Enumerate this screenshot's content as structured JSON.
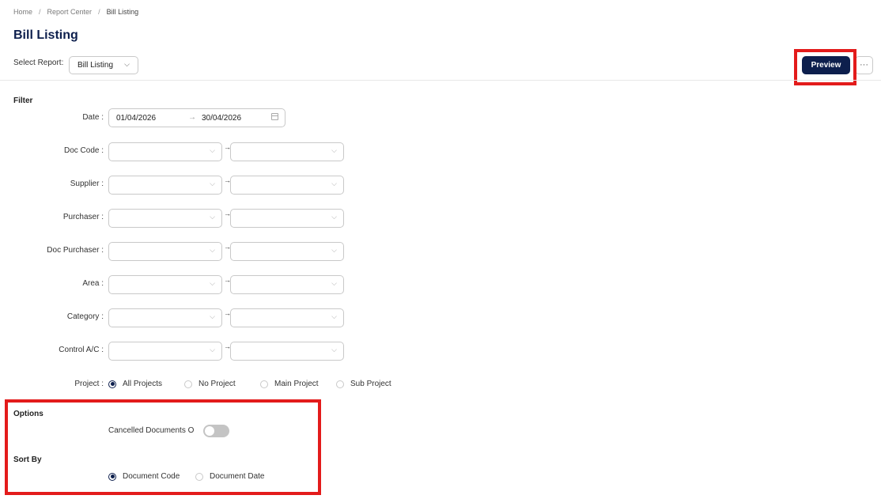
{
  "breadcrumb": {
    "home": "Home",
    "report_center": "Report Center",
    "current": "Bill Listing",
    "separator": "/"
  },
  "page": {
    "title": "Bill Listing"
  },
  "report_selector": {
    "label": "Select Report:",
    "value": "Bill Listing",
    "chevron_icon": "chevron-down-icon"
  },
  "toolbar": {
    "preview_label": "Preview",
    "more_label": "···"
  },
  "filter": {
    "section_title": "Filter",
    "date": {
      "label": "Date :",
      "from": "01/04/2026",
      "to": "30/04/2026",
      "range_arrow": "→",
      "icon": "calendar-icon"
    },
    "ranges": [
      {
        "label": "Doc Code :"
      },
      {
        "label": "Supplier :"
      },
      {
        "label": "Purchaser :"
      },
      {
        "label": "Doc Purchaser :"
      },
      {
        "label": "Area :"
      },
      {
        "label": "Category :"
      },
      {
        "label": "Control A/C :"
      }
    ],
    "range_arrow": "→",
    "project": {
      "label": "Project :",
      "options": [
        "All Projects",
        "No Project",
        "Main Project",
        "Sub Project"
      ],
      "selected": "All Projects"
    }
  },
  "options": {
    "section_title": "Options",
    "cancelled_documents_label": "Cancelled Documents O",
    "cancelled_documents_on": false
  },
  "sort_by": {
    "section_title": "Sort By",
    "options": [
      "Document Code",
      "Document Date"
    ],
    "selected": "Document Code"
  },
  "colors": {
    "primary": "#0d1f4d",
    "highlight": "#e31b1b",
    "border": "#c9c9c9"
  }
}
